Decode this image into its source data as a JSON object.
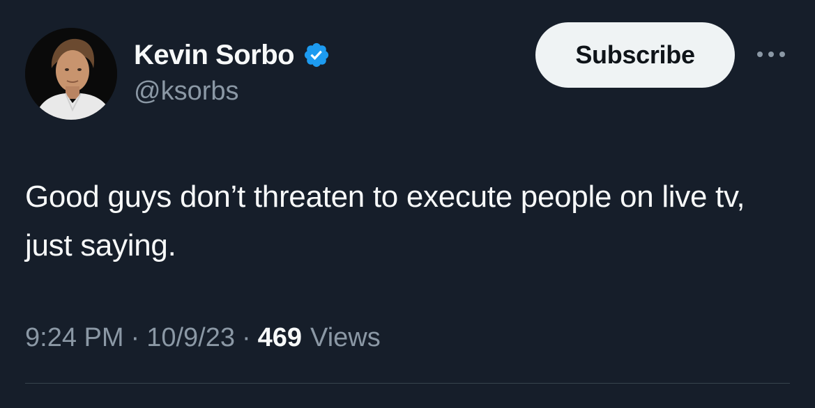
{
  "tweet": {
    "author": {
      "display_name": "Kevin Sorbo",
      "handle": "@ksorbs",
      "verified": true,
      "verified_color": "#1d9bf0"
    },
    "subscribe_label": "Subscribe",
    "more_icon": "more-options-icon",
    "text": "Good guys don’t threaten to execute people on live tv, just saying.",
    "time": "9:24 PM",
    "date": "10/9/23",
    "views_count": "469",
    "views_label": "Views",
    "separator": "·"
  },
  "colors": {
    "background": "#161e2a",
    "primary_text": "#f7f9f9",
    "secondary_text": "#8b98a5",
    "button_bg": "#eff3f4",
    "button_text": "#0f1419"
  }
}
